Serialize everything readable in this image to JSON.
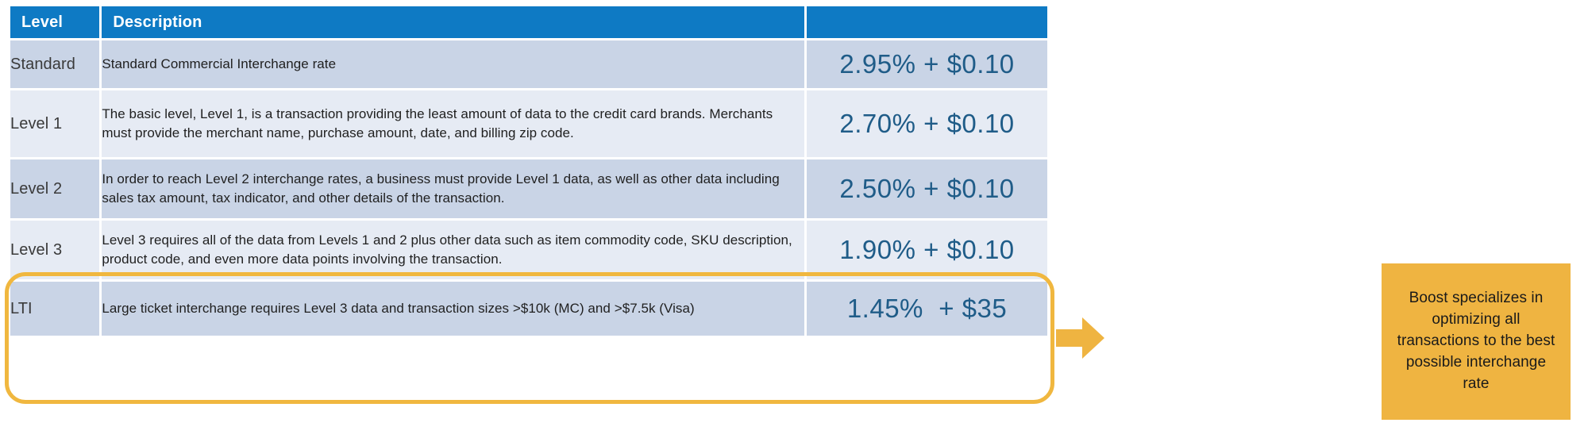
{
  "table": {
    "headers": {
      "level": "Level",
      "description": "Description",
      "rate": ""
    },
    "rows": [
      {
        "level": "Standard",
        "description": "Standard Commercial Interchange rate",
        "rate": "2.95% + $0.10",
        "shade": "dark",
        "highlighted": false
      },
      {
        "level": "Level 1",
        "description": "The basic level, Level 1, is a transaction providing the least amount of data to the credit card brands. Merchants must provide the merchant name, purchase amount, date, and billing zip code.",
        "rate": "2.70% + $0.10",
        "shade": "light",
        "highlighted": false
      },
      {
        "level": "Level 2",
        "description": "In order to reach Level 2 interchange rates, a business must provide Level 1 data, as well as other data including sales tax amount, tax indicator, and other details of the transaction.",
        "rate": "2.50% + $0.10",
        "shade": "dark",
        "highlighted": false
      },
      {
        "level": "Level 3",
        "description": "Level 3 requires all of the data from Levels 1 and 2 plus other data such as item commodity code, SKU description, product code, and even more data points involving the transaction.",
        "rate": "1.90% + $0.10",
        "shade": "light",
        "highlighted": true
      },
      {
        "level": "LTI",
        "description": "Large ticket interchange requires Level 3 data and transaction sizes >$10k (MC) and >$7.5k (Visa)",
        "rate": "1.45%  + $35",
        "shade": "dark",
        "highlighted": true
      }
    ]
  },
  "callout": {
    "text": "Boost specializes in optimizing all transactions to the best possible interchange rate"
  },
  "colors": {
    "header_blue": "#0E7AC4",
    "row_dark": "#C9D4E6",
    "row_light": "#E6EBF4",
    "rate_text": "#1F5C88",
    "highlight_orange": "#F0B73F",
    "callout_orange": "#EFB441",
    "arrow_orange": "#EFB441"
  }
}
